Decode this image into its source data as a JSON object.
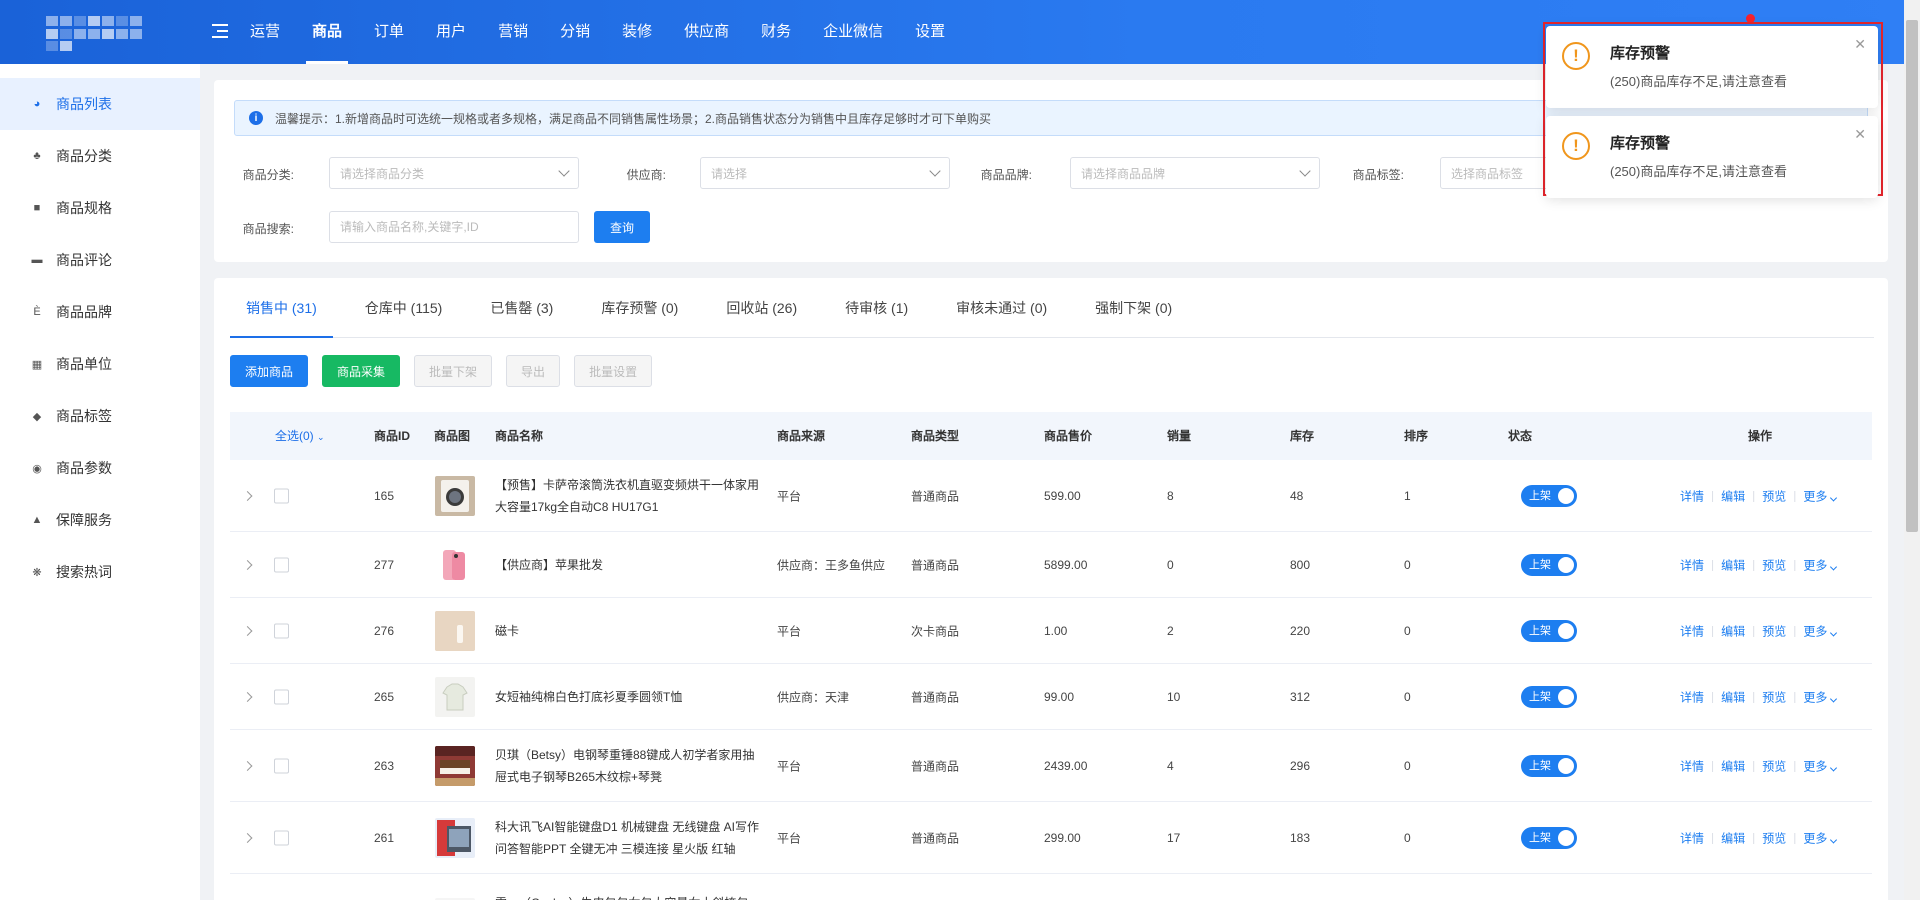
{
  "topnav": {
    "items": [
      "运营",
      "商品",
      "订单",
      "用户",
      "营销",
      "分销",
      "装修",
      "供应商",
      "财务",
      "企业微信",
      "设置"
    ],
    "active_index": 1
  },
  "sidebar": {
    "items": [
      {
        "label": "商品列表",
        "icon": "basket-icon",
        "active": true
      },
      {
        "label": "商品分类",
        "icon": "category-icon"
      },
      {
        "label": "商品规格",
        "icon": "cube-icon"
      },
      {
        "label": "商品评论",
        "icon": "comment-icon"
      },
      {
        "label": "商品品牌",
        "icon": "brand-icon"
      },
      {
        "label": "商品单位",
        "icon": "grid-icon"
      },
      {
        "label": "商品标签",
        "icon": "tag-icon"
      },
      {
        "label": "商品参数",
        "icon": "eye-icon"
      },
      {
        "label": "保障服务",
        "icon": "service-icon"
      },
      {
        "label": "搜索热词",
        "icon": "hotword-icon"
      }
    ]
  },
  "tip": {
    "text": "温馨提示：1.新增商品时可选统一规格或者多规格，满足商品不同销售属性场景；2.商品销售状态分为销售中且库存足够时才可下单购买"
  },
  "filters": {
    "category_label": "商品分类:",
    "category_placeholder": "请选择商品分类",
    "supplier_label": "供应商:",
    "supplier_placeholder": "请选择",
    "brand_label": "商品品牌:",
    "brand_placeholder": "请选择商品品牌",
    "tag_label": "商品标签:",
    "tag_placeholder": "选择商品标签",
    "search_label": "商品搜索:",
    "search_placeholder": "请输入商品名称,关键字,ID",
    "query_button": "查询"
  },
  "tabs": [
    "销售中 (31)",
    "仓库中 (115)",
    "已售罄 (3)",
    "库存预警 (0)",
    "回收站 (26)",
    "待审核 (1)",
    "审核未通过 (0)",
    "强制下架 (0)"
  ],
  "actions": {
    "add": "添加商品",
    "collect": "商品采集",
    "batch_off": "批量下架",
    "export": "导出",
    "batch_set": "批量设置"
  },
  "table": {
    "headers": {
      "select_all": "全选(0)",
      "id": "商品ID",
      "image": "商品图",
      "name": "商品名称",
      "source": "商品来源",
      "type": "商品类型",
      "price": "商品售价",
      "sales": "销量",
      "stock": "库存",
      "sort": "排序",
      "status": "状态",
      "ops": "操作"
    },
    "ops_labels": {
      "detail": "详情",
      "edit": "编辑",
      "preview": "预览",
      "more": "更多"
    },
    "switch_label": "上架",
    "rows": [
      {
        "id": "165",
        "name": "【预售】卡萨帝滚筒洗衣机直驱变频烘干一体家用大容量17kg全自动C8 HU17G1",
        "source": "平台",
        "type": "普通商品",
        "price": "599.00",
        "sales": "8",
        "stock": "48",
        "sort": "1",
        "thumb": "washer"
      },
      {
        "id": "277",
        "name": "【供应商】苹果批发",
        "source": "供应商：王多鱼供应",
        "type": "普通商品",
        "price": "5899.00",
        "sales": "0",
        "stock": "800",
        "sort": "0",
        "thumb": "phone"
      },
      {
        "id": "276",
        "name": "磁卡",
        "source": "平台",
        "type": "次卡商品",
        "price": "1.00",
        "sales": "2",
        "stock": "220",
        "sort": "0",
        "thumb": "card"
      },
      {
        "id": "265",
        "name": "女短袖纯棉白色打底衫夏季圆领T恤",
        "source": "供应商：天津",
        "type": "普通商品",
        "price": "99.00",
        "sales": "10",
        "stock": "312",
        "sort": "0",
        "thumb": "shirt"
      },
      {
        "id": "263",
        "name": "贝琪（Betsy）电钢琴重锤88键成人初学者家用抽屉式电子钢琴B265木纹棕+琴凳",
        "source": "平台",
        "type": "普通商品",
        "price": "2439.00",
        "sales": "4",
        "stock": "296",
        "sort": "0",
        "thumb": "piano"
      },
      {
        "id": "261",
        "name": "科大讯飞AI智能键盘D1 机械键盘 无线键盘 AI写作 问答智能PPT 全键无冲 三模连接 星火版 红轴",
        "source": "平台",
        "type": "普通商品",
        "price": "299.00",
        "sales": "17",
        "stock": "183",
        "sort": "0",
        "thumb": "keyboard"
      },
      {
        "id": "",
        "name": "雪一（Cooles）牛皮包包女包大容量女士斜挎包",
        "source": "",
        "type": "",
        "price": "",
        "sales": "",
        "stock": "",
        "sort": "",
        "thumb": "bag",
        "partial": true
      }
    ]
  },
  "notifications": [
    {
      "title": "库存预警",
      "message": "(250)商品库存不足,请注意查看"
    },
    {
      "title": "库存预警",
      "message": "(250)商品库存不足,请注意查看"
    }
  ],
  "colors": {
    "primary": "#1d7ef0",
    "success": "#17b963",
    "warning": "#f0961c",
    "highlight_border": "#e5252c"
  }
}
